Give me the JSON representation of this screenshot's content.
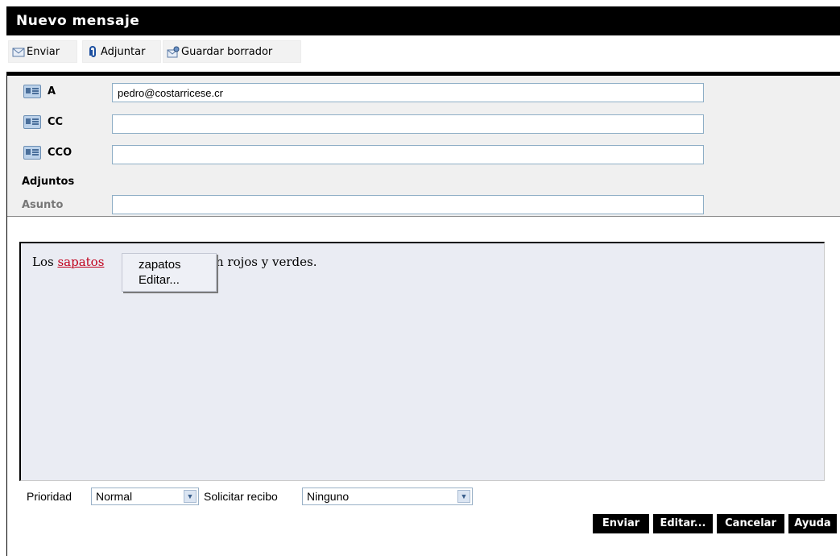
{
  "window": {
    "title": "Nuevo mensaje"
  },
  "toolbar": {
    "send_label": "Enviar",
    "attach_label": "Adjuntar",
    "save_draft_label": "Guardar borrador"
  },
  "headers": {
    "to": {
      "label": "A",
      "value": "pedro@costarricese.cr"
    },
    "cc": {
      "label": "CC",
      "value": ""
    },
    "bcc": {
      "label": "CCO",
      "value": ""
    },
    "attachments_label": "Adjuntos",
    "subject": {
      "label": "Asunto",
      "value": ""
    }
  },
  "body": {
    "text_before": "Los ",
    "misspelled_word": "sapatos",
    "text_after": "n rojos y verdes."
  },
  "spell_menu": {
    "suggestion": "zapatos",
    "edit_label": "Editar..."
  },
  "options": {
    "priority_label": "Prioridad",
    "priority_value": "Normal",
    "receipt_label": "Solicitar recibo",
    "receipt_value": "Ninguno"
  },
  "actions": {
    "send": "Enviar",
    "edit": "Editar...",
    "cancel": "Cancelar",
    "help": "Ayuda"
  },
  "colors": {
    "title_bar": "#000000",
    "header_bg": "#f0f0f0",
    "editor_bg": "#eaecf3",
    "misspelled": "#c0001c",
    "input_border": "#8eaec6"
  }
}
